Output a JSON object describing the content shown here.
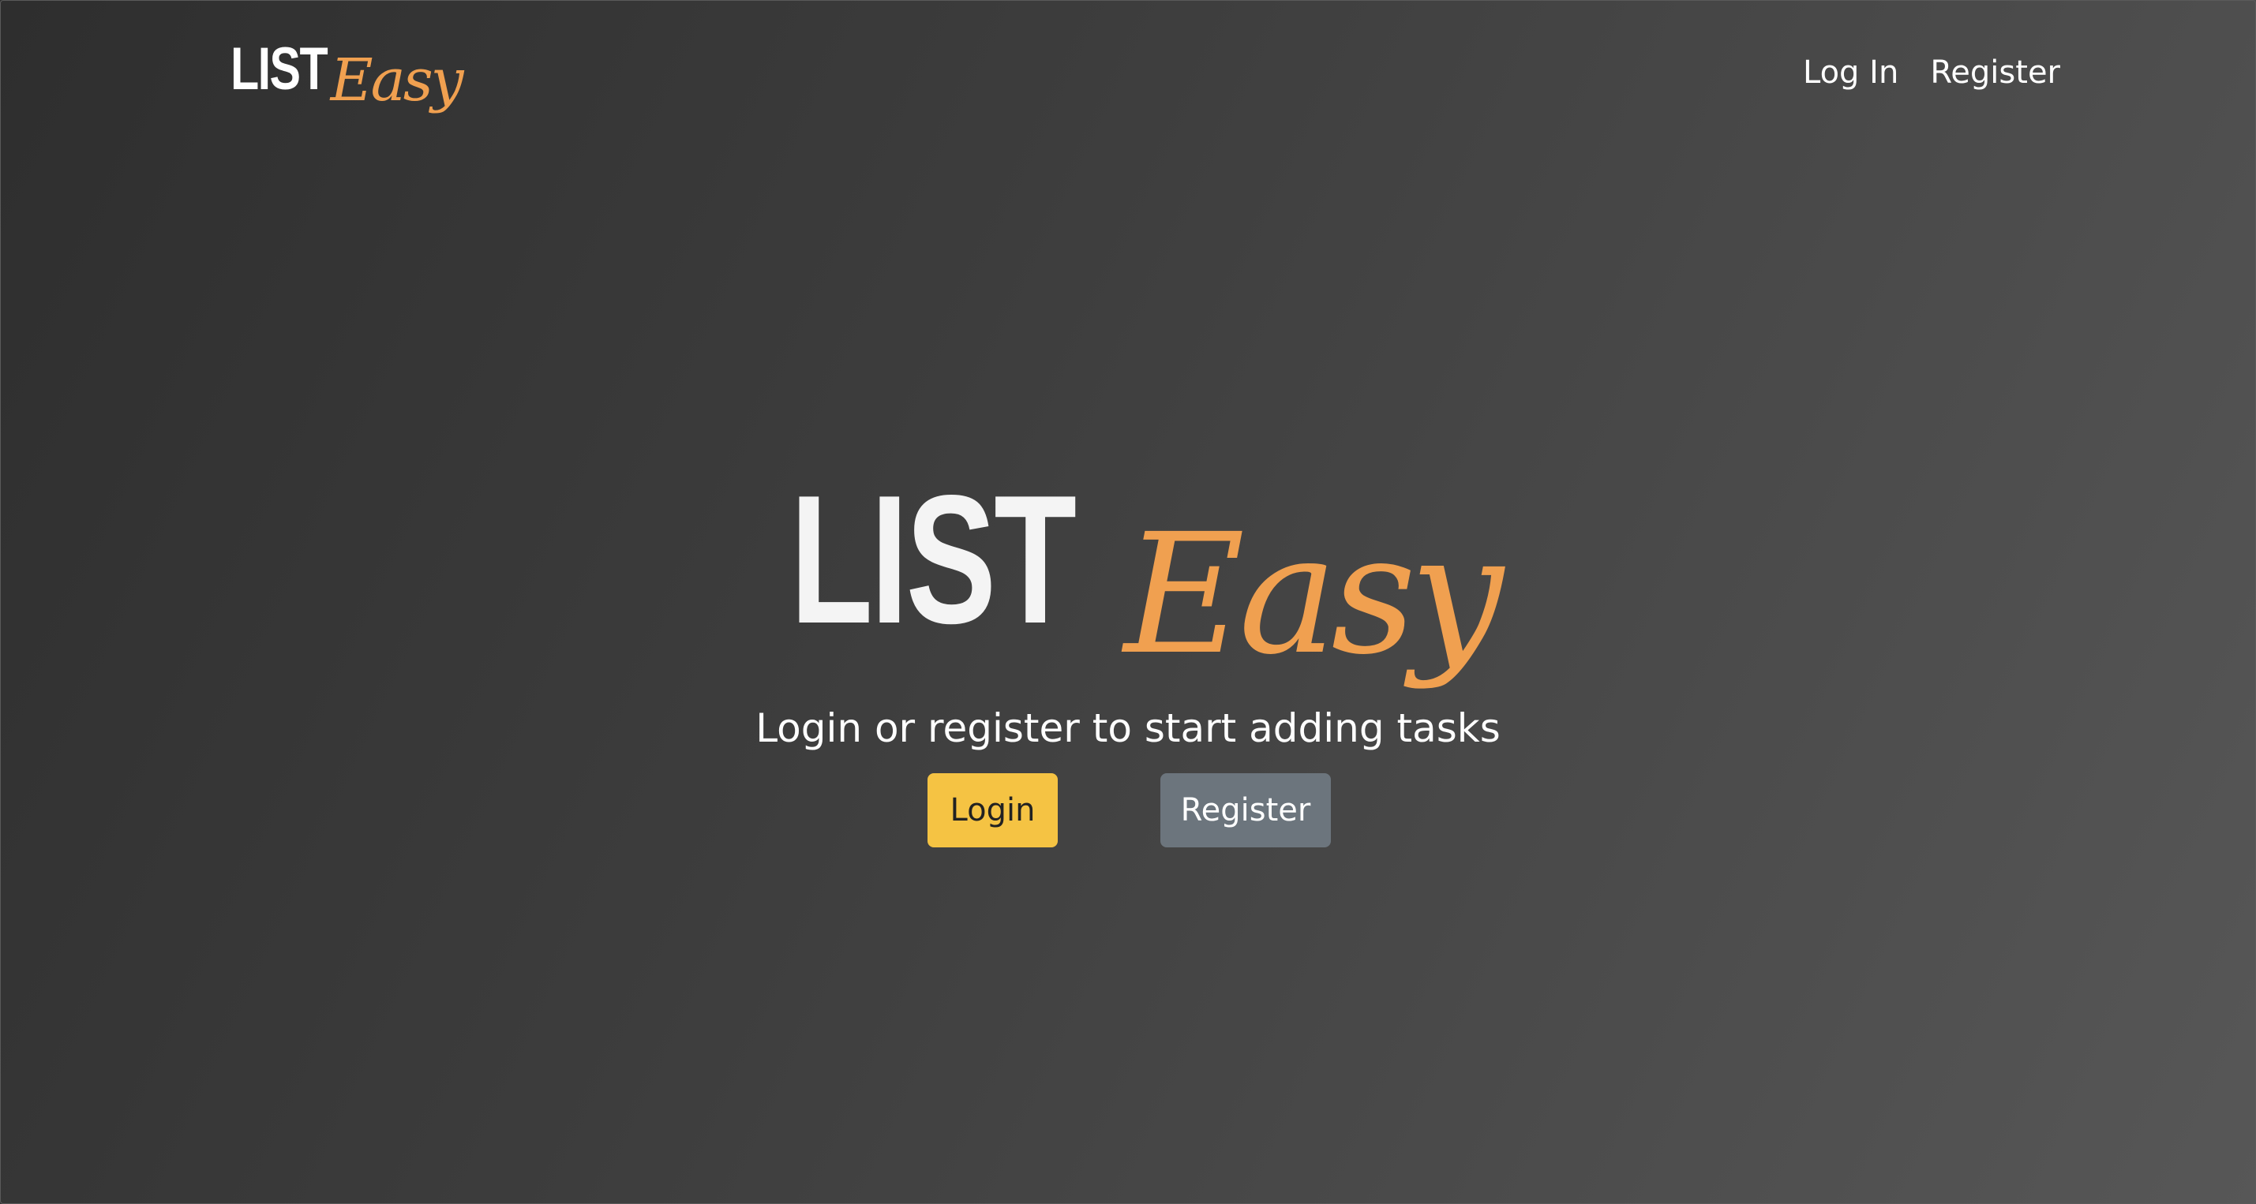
{
  "nav": {
    "logo": {
      "part1": "LIST",
      "part2": "Easy"
    },
    "links": [
      {
        "label": "Log In"
      },
      {
        "label": "Register"
      }
    ]
  },
  "hero": {
    "logo": {
      "part1": "LIST",
      "part2": "Easy"
    },
    "tagline": "Login or register to start adding tasks",
    "buttons": {
      "login_label": "Login",
      "register_label": "Register"
    }
  },
  "colors": {
    "logo_accent": "#f0a050",
    "login_button": "#f5c343",
    "register_button": "#6c757d",
    "background_dark": "#2e2e2e",
    "background_light": "#575757"
  }
}
